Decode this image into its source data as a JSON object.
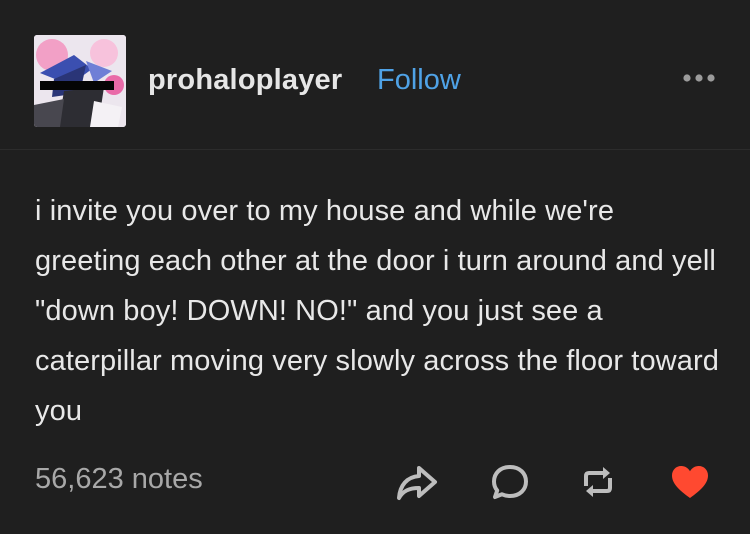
{
  "post": {
    "author": {
      "username": "prohaloplayer",
      "follow_label": "Follow",
      "avatar_icon": "avatar-image"
    },
    "more_icon": "more-horizontal-icon",
    "body": "i invite you over to my house and while we're greeting each other at the door i turn around and yell \"down boy! DOWN! NO!\" and you just see a caterpillar moving very slowly across the floor toward you",
    "notes": "56,623 notes",
    "actions": [
      {
        "name": "share",
        "icon": "share-arrow-icon"
      },
      {
        "name": "reply",
        "icon": "speech-bubble-icon"
      },
      {
        "name": "reblog",
        "icon": "reblog-icon"
      },
      {
        "name": "like",
        "icon": "heart-icon",
        "liked": true
      }
    ]
  },
  "colors": {
    "background": "#1f1f1f",
    "text": "#e8e8e8",
    "follow": "#4fa2e6",
    "notes": "#a8a8a8",
    "icon": "#bdbdbd",
    "like": "#ff4930"
  }
}
